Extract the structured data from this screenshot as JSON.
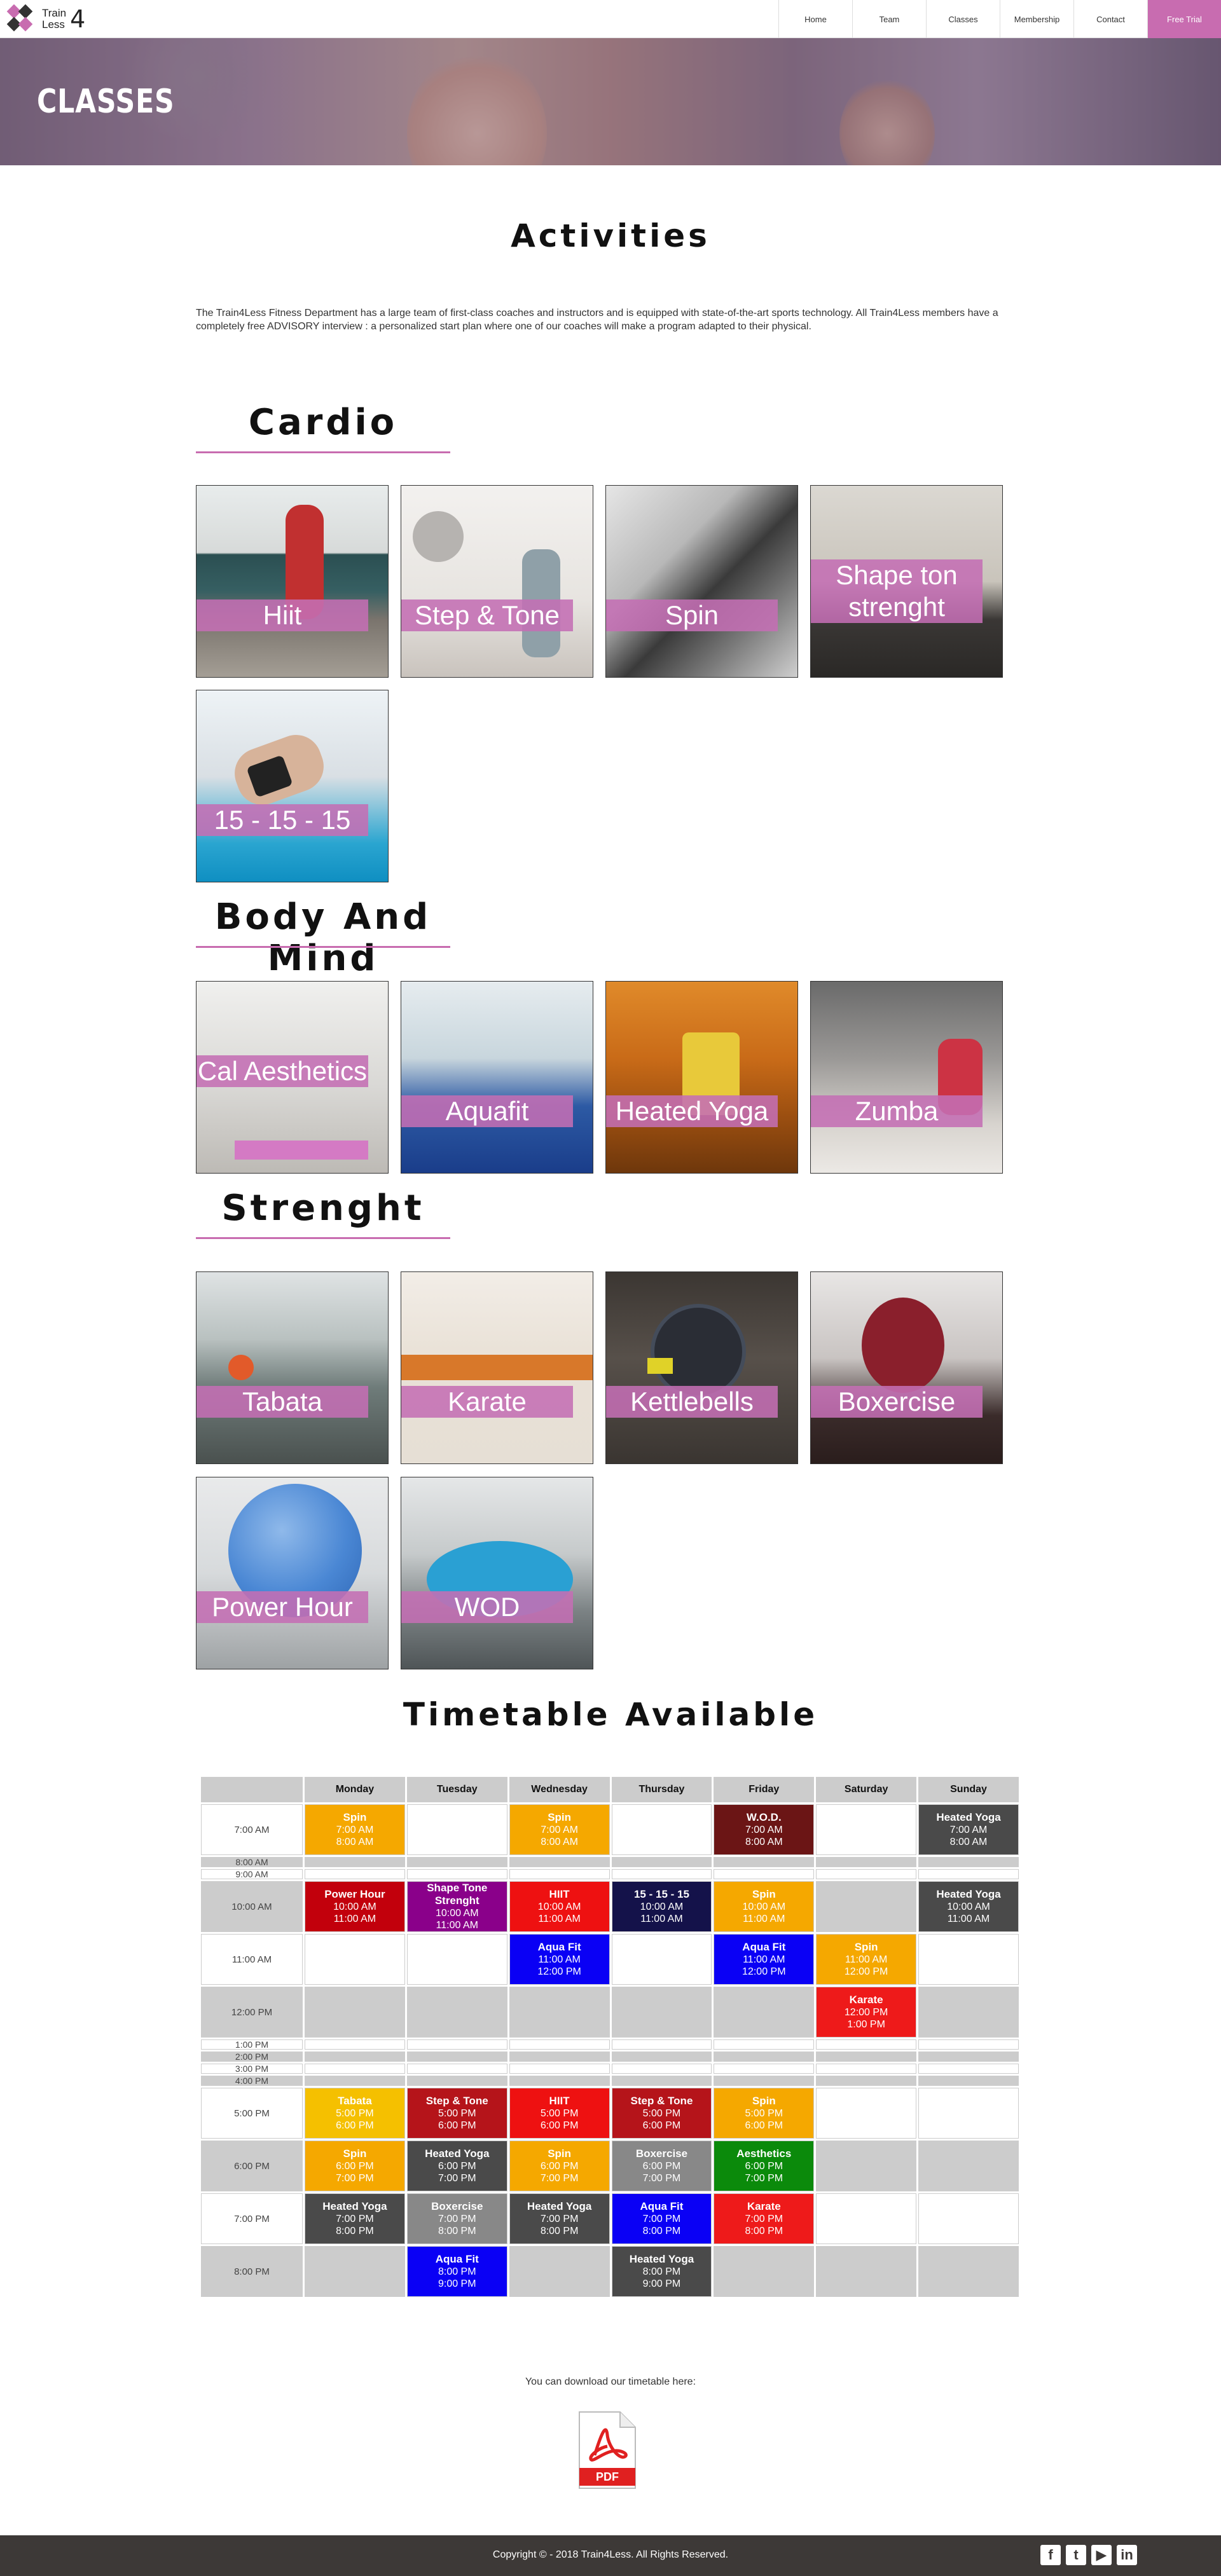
{
  "nav": {
    "logo": {
      "line1": "Train",
      "line2": "Less",
      "digit": "4"
    },
    "items": [
      {
        "label": "Home"
      },
      {
        "label": "Team"
      },
      {
        "label": "Classes"
      },
      {
        "label": "Membership"
      },
      {
        "label": "Contact"
      },
      {
        "label": "Free Trial"
      }
    ]
  },
  "hero": {
    "title": "CLASSES"
  },
  "activities": {
    "title": "Activities",
    "intro": "The Train4Less Fitness Department has a large team of first-class coaches and instructors and is equipped with state-of-the-art sports technology. All Train4Less members have a completely free ADVISORY interview : a personalized start plan where one of our coaches will make a program adapted to their physical."
  },
  "sections": [
    {
      "title": "Cardio",
      "classes": [
        {
          "label": "Hiit",
          "icon": "hiit-photo"
        },
        {
          "label": "Step & Tone",
          "icon": "rings-photo"
        },
        {
          "label": "Spin",
          "icon": "spin-bike-photo"
        },
        {
          "label": "Shape ton strenght",
          "icon": "gym-legs-photo"
        },
        {
          "label": "15 - 15 - 15",
          "icon": "smartwatch-photo"
        }
      ]
    },
    {
      "title": "Body And Mind",
      "classes": [
        {
          "label": "Cal Aesthetics",
          "icon": "mat-photo"
        },
        {
          "label": "Aquafit",
          "icon": "pool-photo"
        },
        {
          "label": "Heated Yoga",
          "icon": "sauna-photo"
        },
        {
          "label": "Zumba",
          "icon": "high-five-photo"
        }
      ]
    },
    {
      "title": "Strenght",
      "classes": [
        {
          "label": "Tabata",
          "icon": "gym-hall-photo"
        },
        {
          "label": "Karate",
          "icon": "karate-belt-photo"
        },
        {
          "label": "Kettlebells",
          "icon": "kettlebell-photo"
        },
        {
          "label": "Boxercise",
          "icon": "boxing-helmet-photo"
        },
        {
          "label": "Power Hour",
          "icon": "exercise-ball-photo"
        },
        {
          "label": "WOD",
          "icon": "dumbbells-photo"
        }
      ]
    }
  ],
  "timetable": {
    "title": "Timetable Available",
    "days": [
      "",
      "Monday",
      "Tuesday",
      "Wednesday",
      "Thursday",
      "Friday",
      "Saturday",
      "Sunday"
    ],
    "rows": [
      {
        "time": "7:00 AM",
        "tall": true,
        "cells": [
          {
            "name": "Spin",
            "start": "7:00 AM",
            "end": "8:00 AM",
            "color": "#f5a800"
          },
          null,
          {
            "name": "Spin",
            "start": "7:00 AM",
            "end": "8:00 AM",
            "color": "#f5a800"
          },
          null,
          {
            "name": "W.O.D.",
            "start": "7:00 AM",
            "end": "8:00 AM",
            "color": "#6b1515"
          },
          null,
          {
            "name": "Heated Yoga",
            "start": "7:00 AM",
            "end": "8:00 AM",
            "color": "#4a4a4a"
          }
        ]
      },
      {
        "time": "8:00 AM",
        "tall": false,
        "cells": [
          null,
          null,
          null,
          null,
          null,
          null,
          null
        ]
      },
      {
        "time": "9:00 AM",
        "tall": false,
        "cells": [
          null,
          null,
          null,
          null,
          null,
          null,
          null
        ]
      },
      {
        "time": "10:00 AM",
        "tall": true,
        "cells": [
          {
            "name": "Power Hour",
            "start": "10:00 AM",
            "end": "11:00 AM",
            "color": "#c2000c"
          },
          {
            "name": "Shape Tone Strenght",
            "start": "10:00 AM",
            "end": "11:00 AM",
            "color": "#8a008a"
          },
          {
            "name": "HIIT",
            "start": "10:00 AM",
            "end": "11:00 AM",
            "color": "#ee1111"
          },
          {
            "name": "15 - 15 - 15",
            "start": "10:00 AM",
            "end": "11:00 AM",
            "color": "#14124a"
          },
          {
            "name": "Spin",
            "start": "10:00 AM",
            "end": "11:00 AM",
            "color": "#f5a800"
          },
          null,
          {
            "name": "Heated Yoga",
            "start": "10:00 AM",
            "end": "11:00 AM",
            "color": "#4a4a4a"
          }
        ]
      },
      {
        "time": "11:00 AM",
        "tall": true,
        "cells": [
          null,
          null,
          {
            "name": "Aqua Fit",
            "start": "11:00 AM",
            "end": "12:00 PM",
            "color": "#0a00f5"
          },
          null,
          {
            "name": "Aqua Fit",
            "start": "11:00 AM",
            "end": "12:00 PM",
            "color": "#0a00f5"
          },
          {
            "name": "Spin",
            "start": "11:00 AM",
            "end": "12:00 PM",
            "color": "#f5a800"
          },
          null
        ]
      },
      {
        "time": "12:00 PM",
        "tall": true,
        "cells": [
          null,
          null,
          null,
          null,
          null,
          {
            "name": "Karate",
            "start": "12:00 PM",
            "end": "1:00 PM",
            "color": "#ee1a1a"
          },
          null
        ]
      },
      {
        "time": "1:00 PM",
        "tall": false,
        "cells": [
          null,
          null,
          null,
          null,
          null,
          null,
          null
        ]
      },
      {
        "time": "2:00 PM",
        "tall": false,
        "cells": [
          null,
          null,
          null,
          null,
          null,
          null,
          null
        ]
      },
      {
        "time": "3:00 PM",
        "tall": false,
        "cells": [
          null,
          null,
          null,
          null,
          null,
          null,
          null
        ]
      },
      {
        "time": "4:00 PM",
        "tall": false,
        "cells": [
          null,
          null,
          null,
          null,
          null,
          null,
          null
        ]
      },
      {
        "time": "5:00 PM",
        "tall": true,
        "cells": [
          {
            "name": "Tabata",
            "start": "5:00 PM",
            "end": "6:00 PM",
            "color": "#f5c000"
          },
          {
            "name": "Step & Tone",
            "start": "5:00 PM",
            "end": "6:00 PM",
            "color": "#b5141a"
          },
          {
            "name": "HIIT",
            "start": "5:00 PM",
            "end": "6:00 PM",
            "color": "#ee1111"
          },
          {
            "name": "Step & Tone",
            "start": "5:00 PM",
            "end": "6:00 PM",
            "color": "#b5141a"
          },
          {
            "name": "Spin",
            "start": "5:00 PM",
            "end": "6:00 PM",
            "color": "#f5a800"
          },
          null,
          null
        ]
      },
      {
        "time": "6:00 PM",
        "tall": true,
        "cells": [
          {
            "name": "Spin",
            "start": "6:00 PM",
            "end": "7:00 PM",
            "color": "#f5a800"
          },
          {
            "name": "Heated Yoga",
            "start": "6:00 PM",
            "end": "7:00 PM",
            "color": "#4a4a4a"
          },
          {
            "name": "Spin",
            "start": "6:00 PM",
            "end": "7:00 PM",
            "color": "#f5a800"
          },
          {
            "name": "Boxercise",
            "start": "6:00 PM",
            "end": "7:00 PM",
            "color": "#888888"
          },
          {
            "name": "Aesthetics",
            "start": "6:00 PM",
            "end": "7:00 PM",
            "color": "#0b8a0b"
          },
          null,
          null
        ]
      },
      {
        "time": "7:00 PM",
        "tall": true,
        "cells": [
          {
            "name": "Heated Yoga",
            "start": "7:00 PM",
            "end": "8:00 PM",
            "color": "#4a4a4a"
          },
          {
            "name": "Boxercise",
            "start": "7:00 PM",
            "end": "8:00 PM",
            "color": "#888888"
          },
          {
            "name": "Heated Yoga",
            "start": "7:00 PM",
            "end": "8:00 PM",
            "color": "#4a4a4a"
          },
          {
            "name": "Aqua Fit",
            "start": "7:00 PM",
            "end": "8:00 PM",
            "color": "#0a00f5"
          },
          {
            "name": "Karate",
            "start": "7:00 PM",
            "end": "8:00 PM",
            "color": "#ee1a1a"
          },
          null,
          null
        ]
      },
      {
        "time": "8:00 PM",
        "tall": true,
        "cells": [
          null,
          {
            "name": "Aqua Fit",
            "start": "8:00 PM",
            "end": "9:00 PM",
            "color": "#0a00f5"
          },
          null,
          {
            "name": "Heated Yoga",
            "start": "8:00 PM",
            "end": "9:00 PM",
            "color": "#4a4a4a"
          },
          null,
          null,
          null
        ]
      }
    ]
  },
  "download": {
    "text": "You can download our timetable here:",
    "pdf_label": "PDF",
    "icon": "pdf-icon"
  },
  "footer": {
    "copyright": "Copyright © - 2018 Train4Less. All Rights Reserved.",
    "social": [
      {
        "icon": "facebook-icon",
        "glyph": "f"
      },
      {
        "icon": "twitter-icon",
        "glyph": "t"
      },
      {
        "icon": "youtube-icon",
        "glyph": "▶"
      },
      {
        "icon": "linkedin-icon",
        "glyph": "in"
      }
    ]
  },
  "colors": {
    "accent": "#c86cb0",
    "footer": "#3d3937",
    "table_gray": "#cccccc"
  }
}
